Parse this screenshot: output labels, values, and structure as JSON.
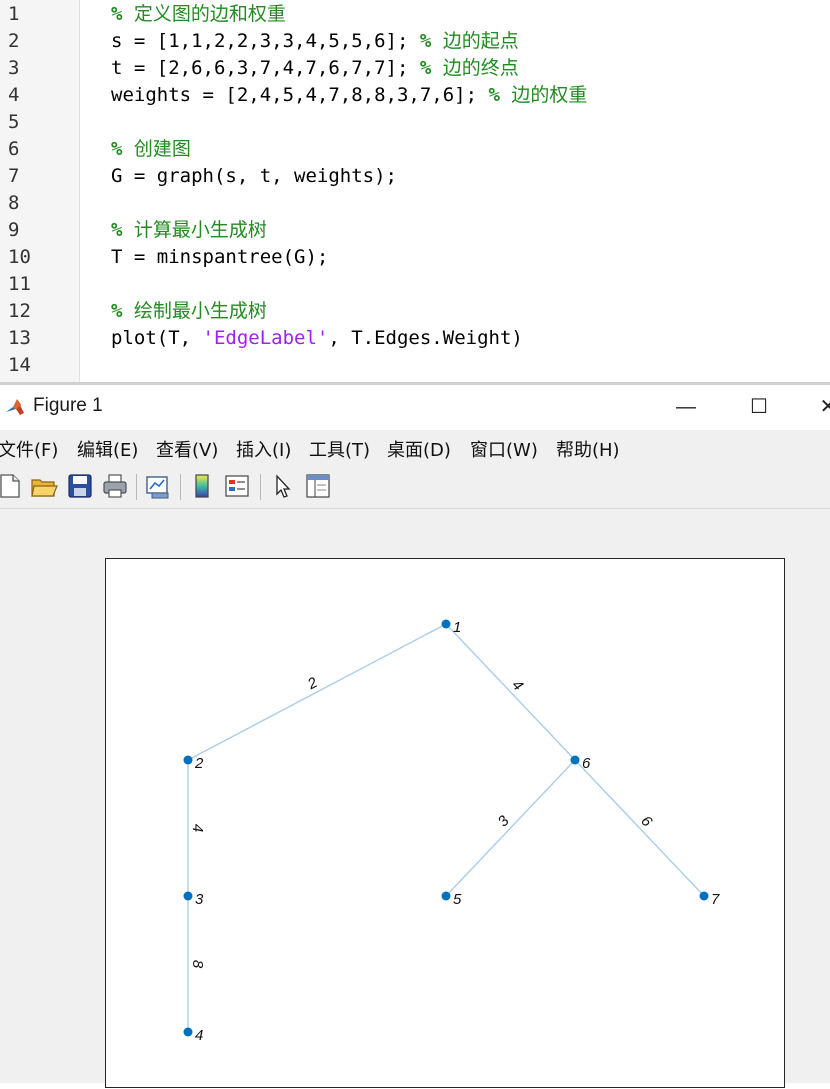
{
  "editor": {
    "lines": [
      {
        "n": "1",
        "segments": [
          {
            "t": "% ",
            "c": "cmpct"
          },
          {
            "t": "定义图的边和权重",
            "c": "cm"
          }
        ]
      },
      {
        "n": "2",
        "segments": [
          {
            "t": "s = [1,1,2,2,3,3,4,5,5,6]; ",
            "c": ""
          },
          {
            "t": "% ",
            "c": "cmpct"
          },
          {
            "t": "边的起点",
            "c": "cm"
          }
        ]
      },
      {
        "n": "3",
        "segments": [
          {
            "t": "t = [2,6,6,3,7,4,7,6,7,7]; ",
            "c": ""
          },
          {
            "t": "% ",
            "c": "cmpct"
          },
          {
            "t": "边的终点",
            "c": "cm"
          }
        ]
      },
      {
        "n": "4",
        "segments": [
          {
            "t": "weights = [2,4,5,4,7,8,8,3,7,6]; ",
            "c": ""
          },
          {
            "t": "% ",
            "c": "cmpct"
          },
          {
            "t": "边的权重",
            "c": "cm"
          }
        ]
      },
      {
        "n": "5",
        "segments": []
      },
      {
        "n": "6",
        "segments": [
          {
            "t": "% ",
            "c": "cmpct"
          },
          {
            "t": "创建图",
            "c": "cm"
          }
        ]
      },
      {
        "n": "7",
        "segments": [
          {
            "t": "G = graph(s, t, weights);",
            "c": ""
          }
        ]
      },
      {
        "n": "8",
        "segments": []
      },
      {
        "n": "9",
        "segments": [
          {
            "t": "% ",
            "c": "cmpct"
          },
          {
            "t": "计算最小生成树",
            "c": "cm"
          }
        ]
      },
      {
        "n": "10",
        "segments": [
          {
            "t": "T = minspantree(G);",
            "c": ""
          }
        ]
      },
      {
        "n": "11",
        "segments": []
      },
      {
        "n": "12",
        "segments": [
          {
            "t": "% ",
            "c": "cmpct"
          },
          {
            "t": "绘制最小生成树",
            "c": "cm"
          }
        ]
      },
      {
        "n": "13",
        "segments": [
          {
            "t": "plot(T, ",
            "c": ""
          },
          {
            "t": "'EdgeLabel'",
            "c": "str"
          },
          {
            "t": ", T.Edges.Weight)",
            "c": ""
          }
        ]
      },
      {
        "n": "14",
        "segments": []
      }
    ]
  },
  "figure": {
    "title": "Figure 1",
    "icon": "matlab-icon",
    "controls": {
      "minimize": "—",
      "maximize": "☐",
      "close": "✕"
    },
    "menu": [
      "文件(F)",
      "编辑(E)",
      "查看(V)",
      "插入(I)",
      "工具(T)",
      "桌面(D)",
      "窗口(W)",
      "帮助(H)"
    ],
    "toolbar": [
      {
        "name": "new-figure-icon"
      },
      {
        "name": "open-file-icon"
      },
      {
        "name": "save-icon"
      },
      {
        "name": "print-icon"
      },
      {
        "name": "link-plot-icon"
      },
      {
        "name": "insert-colorbar-icon"
      },
      {
        "name": "insert-legend-icon"
      },
      {
        "name": "edit-plot-pointer-icon"
      },
      {
        "name": "property-inspector-icon"
      }
    ]
  },
  "chart_data": {
    "type": "graph",
    "colors": {
      "node": "#0072bd",
      "edge": "#a9cde9"
    },
    "nodes": [
      {
        "id": "1",
        "x": 3.0,
        "y": 4.0
      },
      {
        "id": "2",
        "x": 1.0,
        "y": 3.0
      },
      {
        "id": "3",
        "x": 1.0,
        "y": 2.0
      },
      {
        "id": "4",
        "x": 1.0,
        "y": 1.0
      },
      {
        "id": "5",
        "x": 3.0,
        "y": 2.0
      },
      {
        "id": "6",
        "x": 4.0,
        "y": 3.0
      },
      {
        "id": "7",
        "x": 5.0,
        "y": 2.0
      }
    ],
    "edges": [
      {
        "source": "1",
        "target": "2",
        "weight": "2"
      },
      {
        "source": "1",
        "target": "6",
        "weight": "4"
      },
      {
        "source": "2",
        "target": "3",
        "weight": "4"
      },
      {
        "source": "3",
        "target": "4",
        "weight": "8"
      },
      {
        "source": "5",
        "target": "6",
        "weight": "3"
      },
      {
        "source": "6",
        "target": "7",
        "weight": "6"
      }
    ]
  }
}
